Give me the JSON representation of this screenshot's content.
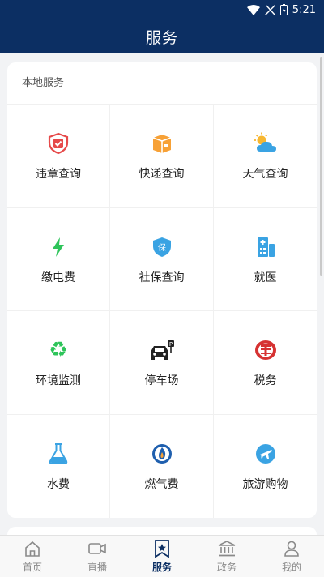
{
  "status_bar": {
    "time": "5:21"
  },
  "header": {
    "title": "服务"
  },
  "section": {
    "title": "本地服务",
    "items": [
      {
        "label": "违章查询",
        "icon": "shield-check-icon"
      },
      {
        "label": "快递查询",
        "icon": "package-icon"
      },
      {
        "label": "天气查询",
        "icon": "weather-icon"
      },
      {
        "label": "缴电费",
        "icon": "lightning-icon"
      },
      {
        "label": "社保查询",
        "icon": "insurance-shield-icon"
      },
      {
        "label": "就医",
        "icon": "hospital-icon"
      },
      {
        "label": "环境监测",
        "icon": "recycle-icon"
      },
      {
        "label": "停车场",
        "icon": "parking-car-icon"
      },
      {
        "label": "税务",
        "icon": "tax-emblem-icon"
      },
      {
        "label": "水费",
        "icon": "flask-icon"
      },
      {
        "label": "燃气费",
        "icon": "gas-flame-icon"
      },
      {
        "label": "旅游购物",
        "icon": "travel-plane-icon"
      }
    ]
  },
  "tabbar": {
    "tabs": [
      {
        "label": "首页",
        "icon": "home-icon"
      },
      {
        "label": "直播",
        "icon": "video-icon"
      },
      {
        "label": "服务",
        "icon": "star-bookmark-icon",
        "active": true
      },
      {
        "label": "政务",
        "icon": "government-building-icon"
      },
      {
        "label": "我的",
        "icon": "user-icon"
      }
    ]
  },
  "colors": {
    "primary": "#0c2f63",
    "inactive": "#8a8a8a"
  }
}
